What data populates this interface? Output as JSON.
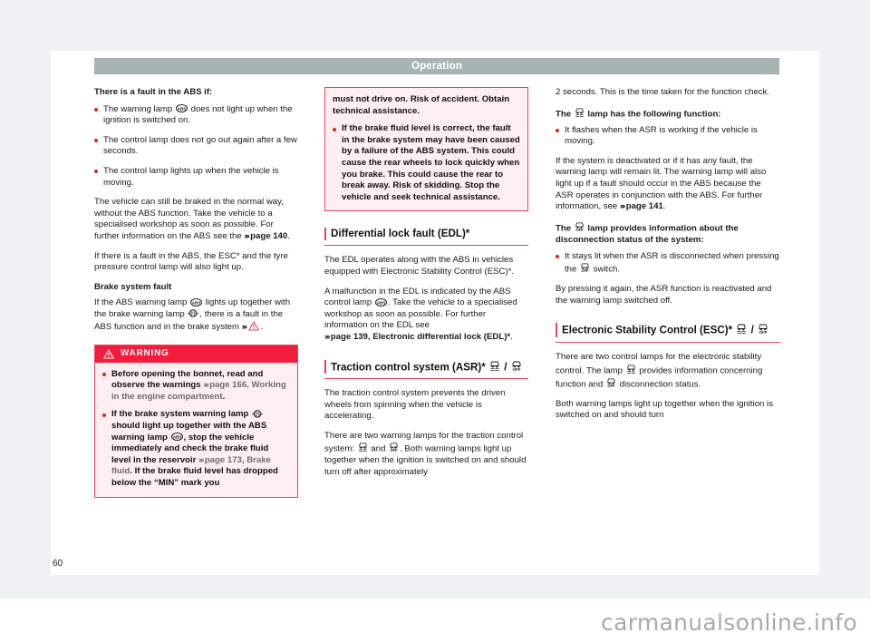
{
  "page": {
    "header_title": "Operation",
    "page_number": "60",
    "watermark": "carmanualsonline.info",
    "accent_red": "#e8455a",
    "warning_red": "#f41c3c",
    "warning_bg": "#fdeef1",
    "header_bar_color": "#a7b4b3",
    "mat_color": "#eef2f3"
  },
  "column_1": {
    "heading": "There is a fault in the ABS if:",
    "bullet_1_a": "The warning lamp",
    "bullet_1_b": "does not light up when the ignition is switched on.",
    "bullet_2": "The control lamp does not go out again after a few seconds.",
    "bullet_3": "The control lamp lights up when the vehicle is moving.",
    "para_1_a": "The vehicle can still be braked in the normal way, without the ABS function. Take the vehicle to a specialised workshop as soon as possible. For further information on the ABS see the",
    "para_1_ref": "page 140",
    "para_1_end": ".",
    "para_2": "If there is a fault in the ABS, the ESC* and the tyre pressure control lamp will also light up.",
    "subheading": "Brake system fault",
    "para_3_a": "If the ABS warning lamp",
    "para_3_b": "lights up together with the brake warning lamp",
    "para_3_c": ", there is a fault in the ABS function and in the brake system",
    "para_3_end": ".",
    "warning_title": "WARNING",
    "warning_b1_a": "Before opening the bonnet, read and observe the warnings",
    "warning_b1_ref": "page 166, Working in the engine compartment",
    "warning_b1_end": ".",
    "warning_b2_a": "If the brake system warning lamp",
    "warning_b2_b": "should light up together with the ABS warning lamp",
    "warning_b2_c": ", stop the vehicle immediately and check the brake fluid level in the reservoir",
    "warning_b2_ref": "page 173, Brake fluid",
    "warning_b2_end": ". If the brake fluid level has dropped below the “MIN” mark you"
  },
  "column_2": {
    "cont_para_1": "must not drive on. Risk of accident. Obtain technical assistance.",
    "cont_bullet_1": "If the brake fluid level is correct, the fault in the brake system may have been caused by a failure of the ABS system. This could cause the rear wheels to lock quickly when you brake. This could cause the rear to break away. Risk of skidding. Stop the vehicle and seek technical assistance.",
    "section_edl": "Differential lock fault (EDL)*",
    "edl_para_1": "The EDL operates along with the ABS in vehicles equipped with Electronic Stability Control (ESC)*.",
    "edl_para_2_a": "A malfunction in the EDL is indicated by the ABS control lamp",
    "edl_para_2_b": ". Take the vehicle to a specialised workshop as soon as possible. For further information on the EDL see",
    "edl_para_2_ref": "page 139, Electronic differential lock (EDL)*",
    "edl_para_2_end": ".",
    "section_asr": "Traction control system (ASR)*",
    "section_asr_sep": "/",
    "asr_para_1": "The traction control system prevents the driven wheels from spinning when the vehicle is accelerating.",
    "asr_para_2_a": "There are two warning lamps for the traction control system:",
    "asr_para_2_b": "and",
    "asr_para_2_c": ". Both warning lamps light up together when the ignition is switched on and should turn off after approximately"
  },
  "column_3": {
    "cont_para_1": "2 seconds. This is the time taken for the function check.",
    "sub_1_a": "The",
    "sub_1_b": "lamp has the following function:",
    "bullet_1": "It flashes when the ASR is working if the vehicle is moving.",
    "para_1_a": "If the system is deactivated or if it has any fault, the warning lamp will remain lit. The warning lamp will also light up if a fault should occur in the ABS because the ASR operates in conjunction with the ABS. For further information, see",
    "para_1_ref": "page 141",
    "para_1_end": ".",
    "sub_2_a": "The",
    "sub_2_b": "lamp provides information about the disconnection status of the system:",
    "bullet_2_a": "It stays lit when the ASR is disconnected when pressing the",
    "bullet_2_b": "switch.",
    "para_2": "By pressing it again, the ASR function is reactivated and the warning lamp switched off.",
    "section_esc": "Electronic Stability Control (ESC)*",
    "section_esc_sep": "/",
    "esc_para_1_a": "There are two control lamps for the electronic stability control. The lamp",
    "esc_para_1_b": "provides information concerning function and",
    "esc_para_1_c": "disconnection status.",
    "esc_para_2": "Both warning lamps light up together when the ignition is switched on and should turn"
  },
  "icons": {
    "abs_lamp": "abs-warning-lamp-icon",
    "brake_lamp": "brake-warning-lamp-icon",
    "warning_triangle": "warning-triangle-icon",
    "asr_flash_lamp": "asr-skid-lamp-icon",
    "asr_off_lamp": "asr-off-lamp-icon"
  }
}
